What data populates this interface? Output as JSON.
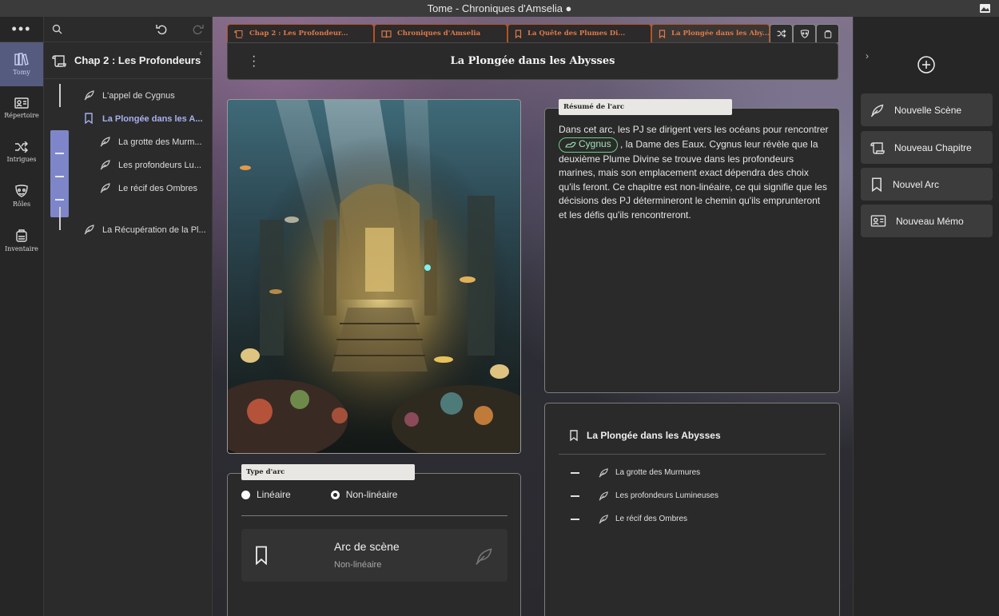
{
  "window": {
    "title": "Tome - Chroniques d'Amselia ●"
  },
  "rail": {
    "items": [
      {
        "label": "Tomy",
        "icon": "books-icon"
      },
      {
        "label": "Répertoire",
        "icon": "contact-card-icon"
      },
      {
        "label": "Intrigues",
        "icon": "shuffle-icon"
      },
      {
        "label": "Rôles",
        "icon": "mask-icon"
      },
      {
        "label": "Inventaire",
        "icon": "backpack-icon"
      }
    ]
  },
  "tree": {
    "header_title": "Chap 2 : Les Profondeurs ...",
    "items": [
      {
        "label": "L'appel de Cygnus"
      },
      {
        "label": "La Plongée dans les A..."
      },
      {
        "label": "La grotte des Murm..."
      },
      {
        "label": "Les profondeurs Lu..."
      },
      {
        "label": "Le récif des Ombres"
      },
      {
        "label": "La Récupération de la Pl..."
      }
    ]
  },
  "tabs": [
    {
      "label": "Chap 2 : Les Profondeur..."
    },
    {
      "label": "Chroniques d'Amselia"
    },
    {
      "label": "La Quête des Plumes Di..."
    },
    {
      "label": "La Plongée dans les Aby..."
    }
  ],
  "document": {
    "title": "La Plongée dans les Abysses"
  },
  "summary": {
    "tag": "Résumé de l'arc",
    "text_before": "Dans cet arc, les PJ se dirigent vers les océans pour rencontrer ",
    "chip": "Cygnus",
    "text_after": " , la Dame des Eaux. Cygnus leur révèle que la deuxième Plume Divine se trouve dans les profondeurs marines, mais son emplacement exact dépendra des choix qu'ils feront. Ce chapitre est non-linéaire, ce qui signifie que les décisions des PJ détermineront le chemin qu'ils emprunteront et les défis qu'ils rencontreront."
  },
  "arc_panel": {
    "title": "La Plongée dans les Abysses",
    "scenes": [
      {
        "label": "La grotte des Murmures"
      },
      {
        "label": "Les profondeurs Lumineuses"
      },
      {
        "label": "Le récif des Ombres"
      }
    ]
  },
  "arc_type": {
    "tag": "Type d'arc",
    "options": [
      {
        "label": "Linéaire"
      },
      {
        "label": "Non-linéaire"
      }
    ],
    "selected": "Non-linéaire",
    "scene_box": {
      "title": "Arc de scène",
      "subtitle": "Non-linéaire"
    }
  },
  "actions": [
    {
      "label": "Nouvelle Scène",
      "icon": "feather-icon"
    },
    {
      "label": "Nouveau Chapitre",
      "icon": "scroll-icon"
    },
    {
      "label": "Nouvel Arc",
      "icon": "bookmark-icon"
    },
    {
      "label": "Nouveau Mémo",
      "icon": "memo-card-icon"
    }
  ],
  "colors": {
    "accent_orange": "#e07a48",
    "tree_active": "#a8b0ef",
    "rail_active": "#545b7e",
    "chip_green": "#6fcf87"
  }
}
